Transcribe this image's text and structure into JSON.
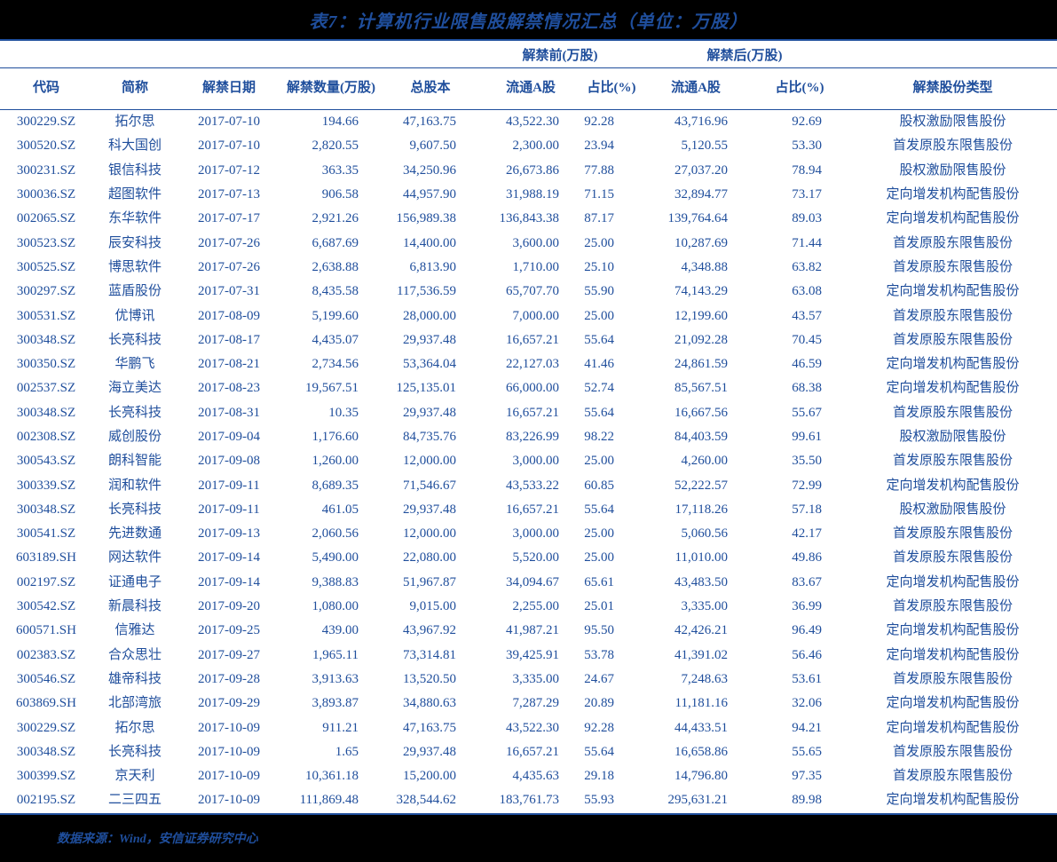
{
  "title": "表7：计算机行业限售股解禁情况汇总（单位：万股）",
  "footer": "数据来源：Wind，安信证券研究中心",
  "colors": {
    "accent": "#1F4E9C",
    "title_bar_bg": "#000000",
    "footer_bar_bg": "#000000",
    "page_bg": "#FFFFFF"
  },
  "header": {
    "groups": [
      {
        "label": "",
        "span": 5
      },
      {
        "label": "解禁前(万股)",
        "span": 2
      },
      {
        "label": "解禁后(万股)",
        "span": 2
      },
      {
        "label": "",
        "span": 1
      }
    ],
    "columns": [
      "代码",
      "简称",
      "解禁日期",
      "解禁数量(万股)",
      "总股本",
      "流通A股",
      "占比(%)",
      "流通A股",
      "占比(%)",
      "解禁股份类型"
    ]
  },
  "rows": [
    {
      "code": "300229.SZ",
      "name": "拓尔思",
      "date": "2017-07-10",
      "qty": "194.66",
      "total": "47,163.75",
      "float_before": "43,522.30",
      "pct_before": "92.28",
      "float_after": "43,716.96",
      "pct_after": "92.69",
      "type": "股权激励限售股份"
    },
    {
      "code": "300520.SZ",
      "name": "科大国创",
      "date": "2017-07-10",
      "qty": "2,820.55",
      "total": "9,607.50",
      "float_before": "2,300.00",
      "pct_before": "23.94",
      "float_after": "5,120.55",
      "pct_after": "53.30",
      "type": "首发原股东限售股份"
    },
    {
      "code": "300231.SZ",
      "name": "银信科技",
      "date": "2017-07-12",
      "qty": "363.35",
      "total": "34,250.96",
      "float_before": "26,673.86",
      "pct_before": "77.88",
      "float_after": "27,037.20",
      "pct_after": "78.94",
      "type": "股权激励限售股份"
    },
    {
      "code": "300036.SZ",
      "name": "超图软件",
      "date": "2017-07-13",
      "qty": "906.58",
      "total": "44,957.90",
      "float_before": "31,988.19",
      "pct_before": "71.15",
      "float_after": "32,894.77",
      "pct_after": "73.17",
      "type": "定向增发机构配售股份"
    },
    {
      "code": "002065.SZ",
      "name": "东华软件",
      "date": "2017-07-17",
      "qty": "2,921.26",
      "total": "156,989.38",
      "float_before": "136,843.38",
      "pct_before": "87.17",
      "float_after": "139,764.64",
      "pct_after": "89.03",
      "type": "定向增发机构配售股份"
    },
    {
      "code": "300523.SZ",
      "name": "辰安科技",
      "date": "2017-07-26",
      "qty": "6,687.69",
      "total": "14,400.00",
      "float_before": "3,600.00",
      "pct_before": "25.00",
      "float_after": "10,287.69",
      "pct_after": "71.44",
      "type": "首发原股东限售股份"
    },
    {
      "code": "300525.SZ",
      "name": "博思软件",
      "date": "2017-07-26",
      "qty": "2,638.88",
      "total": "6,813.90",
      "float_before": "1,710.00",
      "pct_before": "25.10",
      "float_after": "4,348.88",
      "pct_after": "63.82",
      "type": "首发原股东限售股份"
    },
    {
      "code": "300297.SZ",
      "name": "蓝盾股份",
      "date": "2017-07-31",
      "qty": "8,435.58",
      "total": "117,536.59",
      "float_before": "65,707.70",
      "pct_before": "55.90",
      "float_after": "74,143.29",
      "pct_after": "63.08",
      "type": "定向增发机构配售股份"
    },
    {
      "code": "300531.SZ",
      "name": "优博讯",
      "date": "2017-08-09",
      "qty": "5,199.60",
      "total": "28,000.00",
      "float_before": "7,000.00",
      "pct_before": "25.00",
      "float_after": "12,199.60",
      "pct_after": "43.57",
      "type": "首发原股东限售股份"
    },
    {
      "code": "300348.SZ",
      "name": "长亮科技",
      "date": "2017-08-17",
      "qty": "4,435.07",
      "total": "29,937.48",
      "float_before": "16,657.21",
      "pct_before": "55.64",
      "float_after": "21,092.28",
      "pct_after": "70.45",
      "type": "首发原股东限售股份"
    },
    {
      "code": "300350.SZ",
      "name": "华鹏飞",
      "date": "2017-08-21",
      "qty": "2,734.56",
      "total": "53,364.04",
      "float_before": "22,127.03",
      "pct_before": "41.46",
      "float_after": "24,861.59",
      "pct_after": "46.59",
      "type": "定向增发机构配售股份"
    },
    {
      "code": "002537.SZ",
      "name": "海立美达",
      "date": "2017-08-23",
      "qty": "19,567.51",
      "total": "125,135.01",
      "float_before": "66,000.00",
      "pct_before": "52.74",
      "float_after": "85,567.51",
      "pct_after": "68.38",
      "type": "定向增发机构配售股份"
    },
    {
      "code": "300348.SZ",
      "name": "长亮科技",
      "date": "2017-08-31",
      "qty": "10.35",
      "total": "29,937.48",
      "float_before": "16,657.21",
      "pct_before": "55.64",
      "float_after": "16,667.56",
      "pct_after": "55.67",
      "type": "首发原股东限售股份"
    },
    {
      "code": "002308.SZ",
      "name": "威创股份",
      "date": "2017-09-04",
      "qty": "1,176.60",
      "total": "84,735.76",
      "float_before": "83,226.99",
      "pct_before": "98.22",
      "float_after": "84,403.59",
      "pct_after": "99.61",
      "type": "股权激励限售股份"
    },
    {
      "code": "300543.SZ",
      "name": "朗科智能",
      "date": "2017-09-08",
      "qty": "1,260.00",
      "total": "12,000.00",
      "float_before": "3,000.00",
      "pct_before": "25.00",
      "float_after": "4,260.00",
      "pct_after": "35.50",
      "type": "首发原股东限售股份"
    },
    {
      "code": "300339.SZ",
      "name": "润和软件",
      "date": "2017-09-11",
      "qty": "8,689.35",
      "total": "71,546.67",
      "float_before": "43,533.22",
      "pct_before": "60.85",
      "float_after": "52,222.57",
      "pct_after": "72.99",
      "type": "定向增发机构配售股份"
    },
    {
      "code": "300348.SZ",
      "name": "长亮科技",
      "date": "2017-09-11",
      "qty": "461.05",
      "total": "29,937.48",
      "float_before": "16,657.21",
      "pct_before": "55.64",
      "float_after": "17,118.26",
      "pct_after": "57.18",
      "type": "股权激励限售股份"
    },
    {
      "code": "300541.SZ",
      "name": "先进数通",
      "date": "2017-09-13",
      "qty": "2,060.56",
      "total": "12,000.00",
      "float_before": "3,000.00",
      "pct_before": "25.00",
      "float_after": "5,060.56",
      "pct_after": "42.17",
      "type": "首发原股东限售股份"
    },
    {
      "code": "603189.SH",
      "name": "网达软件",
      "date": "2017-09-14",
      "qty": "5,490.00",
      "total": "22,080.00",
      "float_before": "5,520.00",
      "pct_before": "25.00",
      "float_after": "11,010.00",
      "pct_after": "49.86",
      "type": "首发原股东限售股份"
    },
    {
      "code": "002197.SZ",
      "name": "证通电子",
      "date": "2017-09-14",
      "qty": "9,388.83",
      "total": "51,967.87",
      "float_before": "34,094.67",
      "pct_before": "65.61",
      "float_after": "43,483.50",
      "pct_after": "83.67",
      "type": "定向增发机构配售股份"
    },
    {
      "code": "300542.SZ",
      "name": "新晨科技",
      "date": "2017-09-20",
      "qty": "1,080.00",
      "total": "9,015.00",
      "float_before": "2,255.00",
      "pct_before": "25.01",
      "float_after": "3,335.00",
      "pct_after": "36.99",
      "type": "首发原股东限售股份"
    },
    {
      "code": "600571.SH",
      "name": "信雅达",
      "date": "2017-09-25",
      "qty": "439.00",
      "total": "43,967.92",
      "float_before": "41,987.21",
      "pct_before": "95.50",
      "float_after": "42,426.21",
      "pct_after": "96.49",
      "type": "定向增发机构配售股份"
    },
    {
      "code": "002383.SZ",
      "name": "合众思壮",
      "date": "2017-09-27",
      "qty": "1,965.11",
      "total": "73,314.81",
      "float_before": "39,425.91",
      "pct_before": "53.78",
      "float_after": "41,391.02",
      "pct_after": "56.46",
      "type": "定向增发机构配售股份"
    },
    {
      "code": "300546.SZ",
      "name": "雄帝科技",
      "date": "2017-09-28",
      "qty": "3,913.63",
      "total": "13,520.50",
      "float_before": "3,335.00",
      "pct_before": "24.67",
      "float_after": "7,248.63",
      "pct_after": "53.61",
      "type": "首发原股东限售股份"
    },
    {
      "code": "603869.SH",
      "name": "北部湾旅",
      "date": "2017-09-29",
      "qty": "3,893.87",
      "total": "34,880.63",
      "float_before": "7,287.29",
      "pct_before": "20.89",
      "float_after": "11,181.16",
      "pct_after": "32.06",
      "type": "定向增发机构配售股份"
    },
    {
      "code": "300229.SZ",
      "name": "拓尔思",
      "date": "2017-10-09",
      "qty": "911.21",
      "total": "47,163.75",
      "float_before": "43,522.30",
      "pct_before": "92.28",
      "float_after": "44,433.51",
      "pct_after": "94.21",
      "type": "定向增发机构配售股份"
    },
    {
      "code": "300348.SZ",
      "name": "长亮科技",
      "date": "2017-10-09",
      "qty": "1.65",
      "total": "29,937.48",
      "float_before": "16,657.21",
      "pct_before": "55.64",
      "float_after": "16,658.86",
      "pct_after": "55.65",
      "type": "首发原股东限售股份"
    },
    {
      "code": "300399.SZ",
      "name": "京天利",
      "date": "2017-10-09",
      "qty": "10,361.18",
      "total": "15,200.00",
      "float_before": "4,435.63",
      "pct_before": "29.18",
      "float_after": "14,796.80",
      "pct_after": "97.35",
      "type": "首发原股东限售股份"
    },
    {
      "code": "002195.SZ",
      "name": "二三四五",
      "date": "2017-10-09",
      "qty": "111,869.48",
      "total": "328,544.62",
      "float_before": "183,761.73",
      "pct_before": "55.93",
      "float_after": "295,631.21",
      "pct_after": "89.98",
      "type": "定向增发机构配售股份"
    }
  ]
}
